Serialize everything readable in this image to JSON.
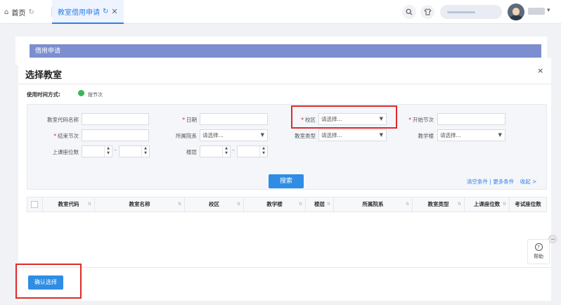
{
  "tabs": {
    "home": {
      "label": "首页",
      "icon": "home-icon"
    },
    "active": {
      "label": "教室借用申请",
      "icon_refresh": "refresh-icon",
      "icon_close": "close-icon"
    }
  },
  "topbar": {
    "search_icon": "search-icon",
    "theme_icon": "shirt-icon"
  },
  "page": {
    "header": "借用申请"
  },
  "modal": {
    "title": "选择教室",
    "close_glyph": "×",
    "mode_label": "使用时间方式:",
    "mode_option": "按节次",
    "fields": {
      "room_code": "教室代码名称",
      "date": "日期",
      "campus": "校区",
      "start_period": "开始节次",
      "end_period": "结束节次",
      "department": "所属院系",
      "room_type": "教室类型",
      "building": "教学楼",
      "seats": "上课座位数",
      "floor": "楼层"
    },
    "select_placeholder": "请选择...",
    "search_btn": "搜索",
    "link_clear": "清空条件",
    "link_more": "更多条件",
    "link_collapse": "收起 >",
    "link_sep": "|",
    "table_columns": [
      "教室代码",
      "教室名称",
      "校区",
      "教学楼",
      "楼层",
      "所属院系",
      "教室类型",
      "上课座位数",
      "考试座位数"
    ],
    "confirm_btn": "确认选择"
  },
  "help": {
    "label": "帮助",
    "glyph": "?"
  },
  "colors": {
    "accent": "#2f8de4",
    "header_bar": "#7c8ecf",
    "required": "#e02020",
    "highlight": "#e02a2a",
    "radio": "#3cb55c"
  }
}
